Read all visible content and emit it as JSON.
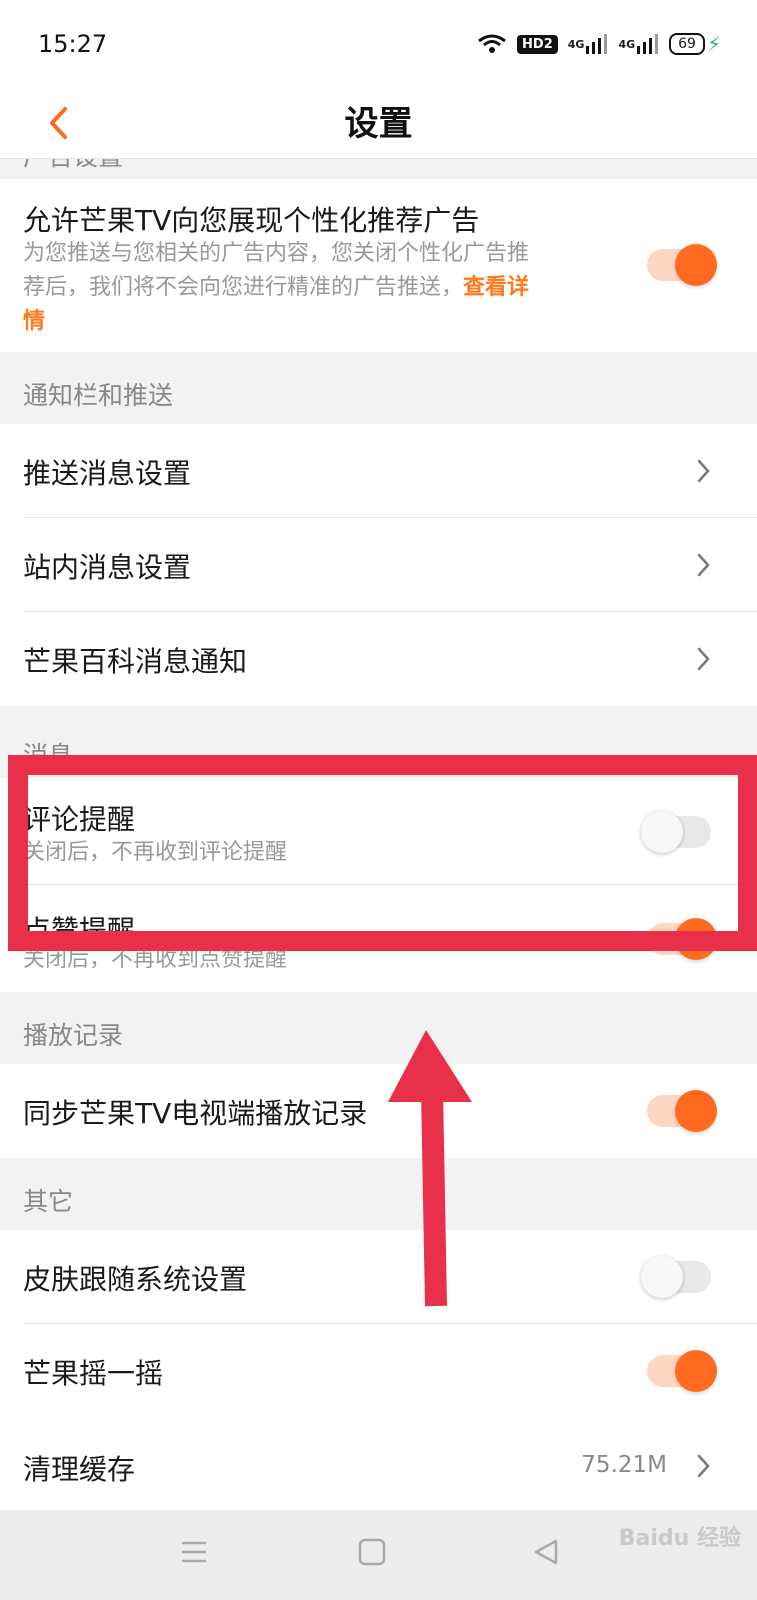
{
  "status_bar": {
    "time": "15:27",
    "hd_label": "HD2",
    "signal1_label": "4G",
    "signal2_label": "4G",
    "battery": "69"
  },
  "nav": {
    "title": "设置",
    "back_icon": "chevron-left-icon"
  },
  "sections": {
    "ads_partial": "广告设置",
    "notify": "通知栏和推送",
    "reminder_partial": "消息",
    "playback": "播放记录",
    "other": "其它"
  },
  "ads_row": {
    "title": "允许芒果TV向您展现个性化推荐广告",
    "desc_line1": "为您推送与您相关的广告内容，您关闭个性化广告推",
    "desc_line2": "荐后，我们将不会向您进行精准的广告推送，",
    "link_part1": "查看详",
    "link_part2": "情",
    "toggle_on": true
  },
  "notify_rows": [
    {
      "title": "推送消息设置"
    },
    {
      "title": "站内消息设置"
    },
    {
      "title": "芒果百科消息通知"
    }
  ],
  "comment_row": {
    "title": "评论提醒",
    "desc": "关闭后，不再收到评论提醒",
    "toggle_on": false
  },
  "like_row": {
    "title": "点赞提醒",
    "desc": "关闭后，不再收到点赞提醒",
    "toggle_on": true
  },
  "sync_row": {
    "title": "同步芒果TV电视端播放记录",
    "toggle_on": true
  },
  "other_rows": {
    "skin": {
      "title": "皮肤跟随系统设置",
      "toggle_on": false
    },
    "shake": {
      "title": "芒果摇一摇",
      "toggle_on": true
    },
    "cache": {
      "title": "清理缓存",
      "value": "75.21M"
    }
  },
  "watermark": "Baidu 经验",
  "colors": {
    "accent": "#ff6a1f",
    "annotation": "#e8304a"
  }
}
